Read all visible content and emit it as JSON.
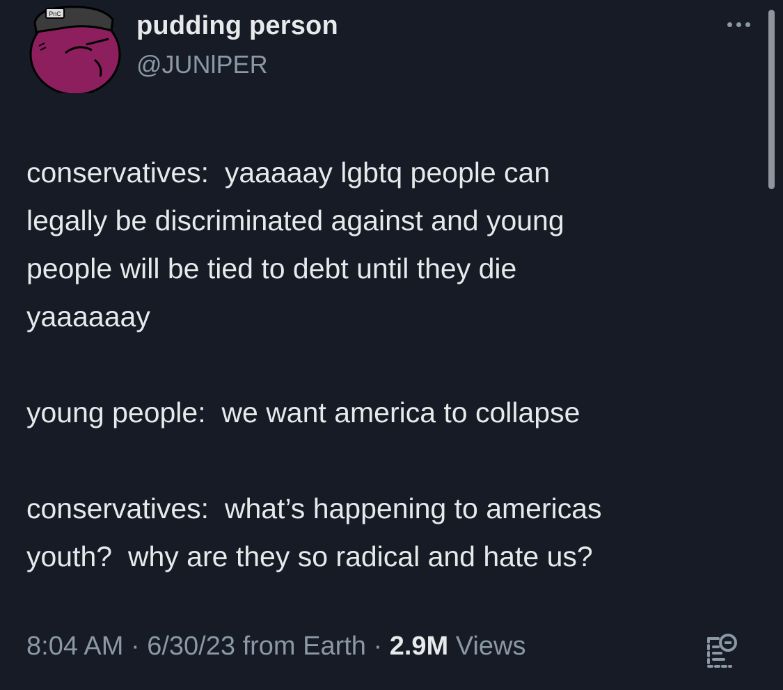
{
  "author": {
    "display_name": "pudding person",
    "handle": "@JUNlPER",
    "avatar_icon": "purple-pudding-character-avatar-icon",
    "avatar_hat_text": "PnC"
  },
  "tweet": {
    "paragraphs": [
      "conservatives:  yaaaaay lgbtq people can\nlegally be discriminated against and young\npeople will be tied to debt until they die\nyaaaaaay",
      "young people:  we want america to collapse",
      "conservatives:  what’s happening to americas\nyouth?  why are they so radical and hate us?"
    ]
  },
  "meta": {
    "time": "8:04 AM",
    "separator": " · ",
    "date": "6/30/23",
    "source": "from Earth",
    "views_count": "2.9M",
    "views_label": " Views"
  },
  "icons": {
    "more": "more-options-icon",
    "analytics": "analytics-icon"
  },
  "colors": {
    "background": "#161b26",
    "primary_text": "#e7e9ea",
    "secondary_text": "#8b98a5",
    "avatar_fill": "#8e1f5e"
  }
}
